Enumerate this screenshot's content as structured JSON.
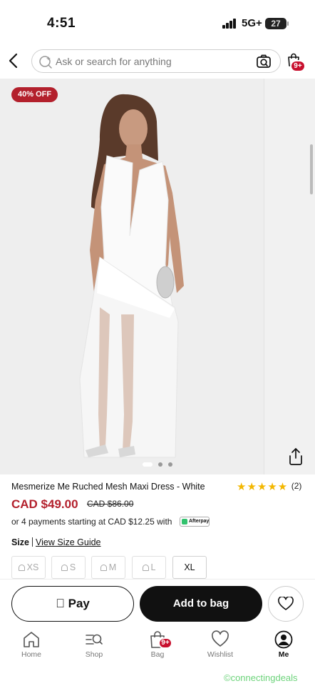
{
  "status_bar": {
    "time": "4:51",
    "network": "5G+",
    "battery": "27"
  },
  "header": {
    "search_placeholder": "Ask or search for anything",
    "bag_badge": "9+"
  },
  "gallery": {
    "discount_badge": "40% OFF",
    "slide_count": 3,
    "active_slide": 1
  },
  "product": {
    "title": "Mesmerize Me Ruched Mesh Maxi Dress - White",
    "rating_stars": "★★★★★",
    "rating_count": "(2)",
    "price": "CAD $49.00",
    "original_price": "CAD $86.00",
    "payments_text": "or 4 payments starting at CAD $12.25 with",
    "payments_provider": "Afterpay",
    "size_label": "Size",
    "size_guide": "View Size Guide",
    "sizes": [
      {
        "label": "XS",
        "available": false
      },
      {
        "label": "S",
        "available": false
      },
      {
        "label": "M",
        "available": false
      },
      {
        "label": "L",
        "available": false
      },
      {
        "label": "XL",
        "available": true
      }
    ]
  },
  "actions": {
    "pay_label": "Pay",
    "add_to_bag_label": "Add to bag"
  },
  "tabbar": {
    "items": [
      {
        "label": "Home",
        "icon": "home-icon"
      },
      {
        "label": "Shop",
        "icon": "shop-search-icon"
      },
      {
        "label": "Bag",
        "icon": "bag-icon",
        "badge": "9+"
      },
      {
        "label": "Wishlist",
        "icon": "heart-icon"
      },
      {
        "label": "Me",
        "icon": "user-icon",
        "active": true
      }
    ]
  },
  "watermark": "©connectingdeals",
  "colors": {
    "accent": "#b3202c",
    "badge": "#c8102e",
    "stars": "#f3b700",
    "primary_button": "#111111"
  }
}
